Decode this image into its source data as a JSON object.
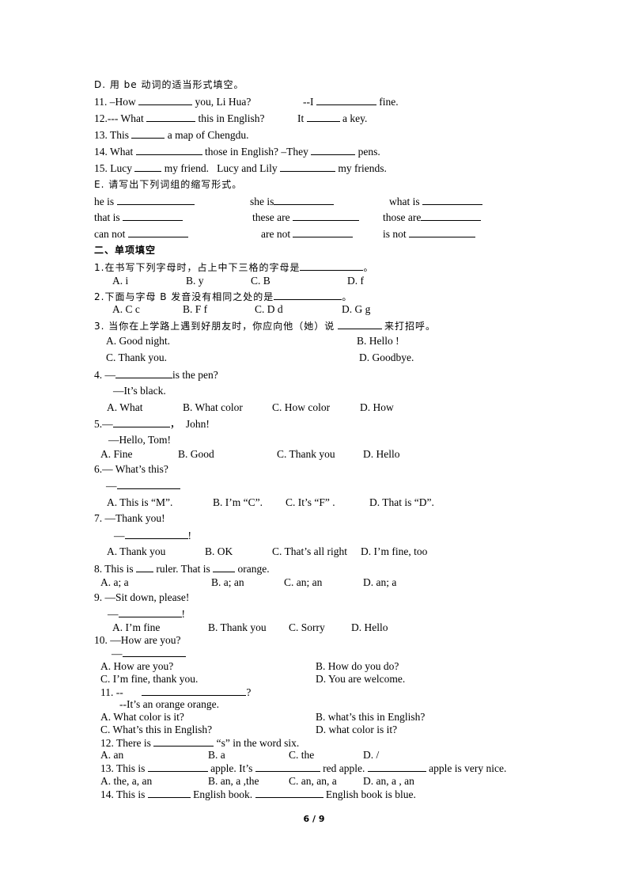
{
  "sectionD": {
    "heading": "D. 用 be 动词的适当形式填空。",
    "q11a": "11. –How",
    "q11b": "you, Li Hua?",
    "q11c": "--I",
    "q11d": "fine.",
    "q12a": "12.--- What",
    "q12b": "this in English?",
    "q12c": "It",
    "q12d": "a key.",
    "q13a": "13. This",
    "q13b": "a map of Chengdu.",
    "q14a": "14. What",
    "q14b": "those in English? –They",
    "q14c": "pens.",
    "q15a": "15. Lucy",
    "q15b": "my friend.",
    "q15c": "Lucy and Lily",
    "q15d": "my friends."
  },
  "sectionE": {
    "heading": "E. 请写出下列词组的缩写形式。",
    "items": [
      "he is",
      "she is",
      "what is",
      "that is",
      "these are",
      "those are",
      "can not",
      "are not",
      "is not"
    ]
  },
  "part2": {
    "heading": "二、单项填空",
    "q1": {
      "stem": "1.在书写下列字母时，占上中下三格的字母是",
      "end": "。",
      "options": [
        "A. i",
        "B. y",
        "C. B",
        "D. f"
      ]
    },
    "q2": {
      "stem": "2.下面与字母 B 发音没有相同之处的是",
      "end": "。",
      "options": [
        "A. C c",
        "B. F f",
        "C. D d",
        "D. G g"
      ]
    },
    "q3": {
      "stem": "3. 当你在上学路上遇到好朋友时，你应向他（她）说",
      "end": "来打招呼。",
      "options": [
        "A. Good night.",
        "B. Hello !",
        "C. Thank you.",
        "D. Goodbye."
      ]
    },
    "q4": {
      "a": "4. —",
      "b": "is the pen?",
      "reply": "—It’s black.",
      "options": [
        "A. What",
        "B. What color",
        "C. How color",
        "D. How"
      ]
    },
    "q5": {
      "a": "5.—",
      "b": "，  John!",
      "reply": "—Hello, Tom!",
      "options": [
        "A. Fine",
        "B. Good",
        "C. Thank you",
        "D. Hello"
      ]
    },
    "q6": {
      "a": "6.— What’s this?",
      "reply": "—",
      "options": [
        "A. This is “M”.",
        "B. I’m “C”.",
        "C. It’s “F” .",
        "D. That is “D”."
      ]
    },
    "q7": {
      "a": "7. —Thank you!",
      "reply": "—",
      "end": "!",
      "options": [
        "A. Thank you",
        "B. OK",
        "C. That’s all right",
        "D. I’m fine, too"
      ]
    },
    "q8": {
      "a": "8. This is",
      "b": "ruler. That is",
      "c": "orange.",
      "options": [
        "A. a; a",
        "B. a; an",
        "C. an; an",
        "D. an; a"
      ]
    },
    "q9": {
      "a": "9. —Sit down, please!",
      "reply": "—",
      "end": "!",
      "options": [
        "A. I’m fine",
        "B. Thank you",
        "C. Sorry",
        "D. Hello"
      ]
    },
    "q10": {
      "a": "10. —How are you?",
      "reply": "—",
      "options": [
        "A. How are you?",
        "B. How do you do?",
        "C. I’m fine, thank you.",
        "D. You are welcome."
      ]
    },
    "q11": {
      "a": "11. --",
      "end": "?",
      "reply": "--It’s an orange orange.",
      "options": [
        "A. What color is it?",
        "B. what’s this in English?",
        "C. What’s this in English?",
        "D. what color is it?"
      ]
    },
    "q12": {
      "a": "12. There is",
      "b": "“s” in the word six.",
      "options": [
        "A. an",
        "B. a",
        "C. the",
        "D. /"
      ]
    },
    "q13": {
      "a": "13. This is",
      "b": "apple. It’s",
      "c": "red apple.",
      "d": "apple is very nice.",
      "options": [
        "A. the, a, an",
        "B. an, a ,the",
        "C. an, an, a",
        "D. an, a , an"
      ]
    },
    "q14": {
      "a": "14. This is",
      "b": "English book.",
      "c": "English book is blue."
    }
  },
  "footer": {
    "page": "6 / 9"
  }
}
